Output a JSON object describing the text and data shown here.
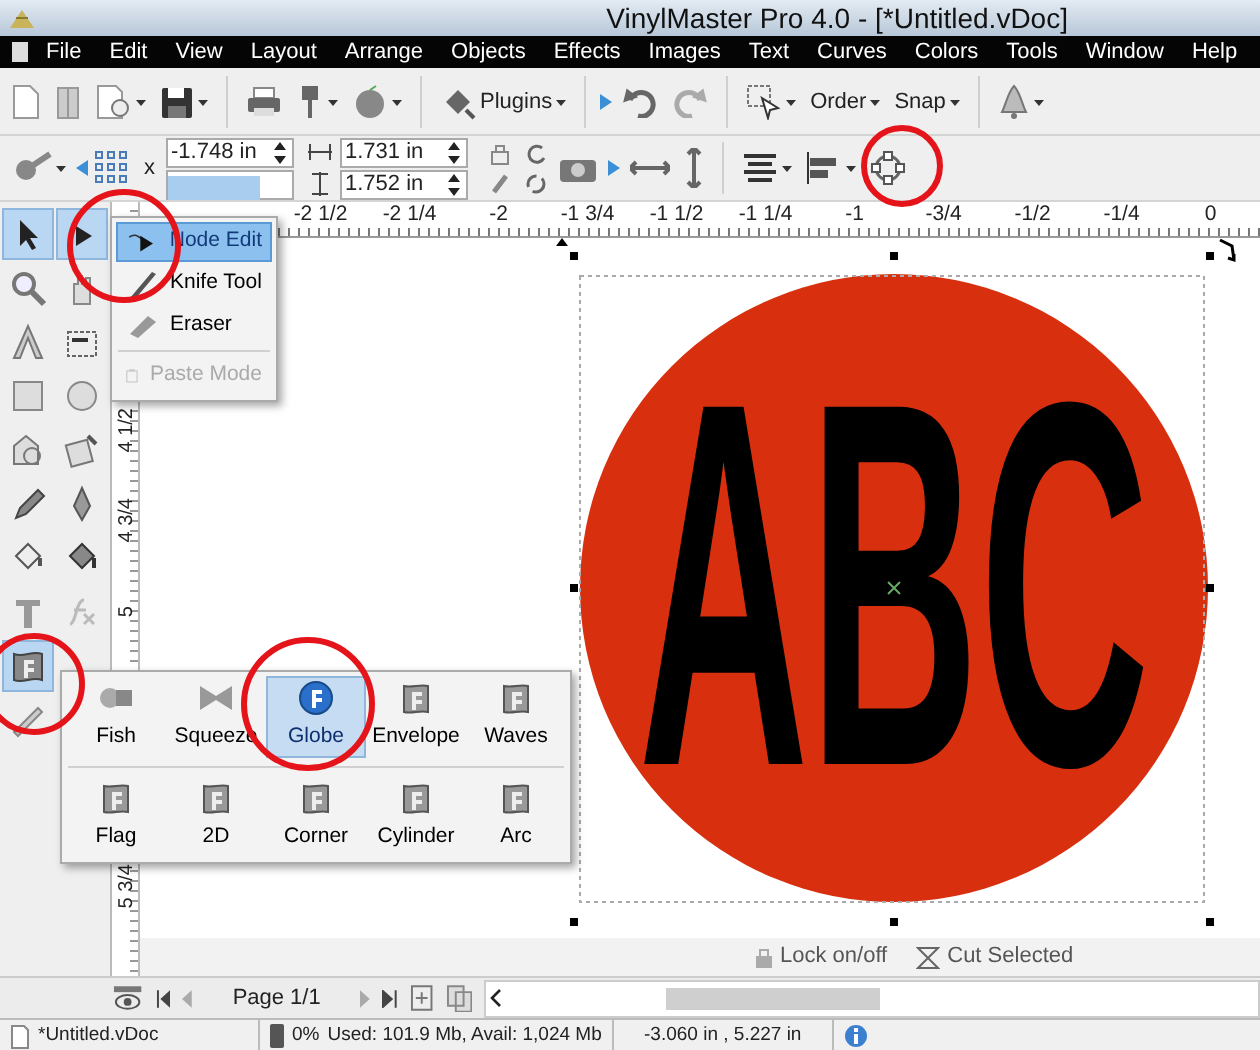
{
  "window": {
    "title": "VinylMaster Pro 4.0 - [*Untitled.vDoc]"
  },
  "menu": [
    "File",
    "Edit",
    "View",
    "Layout",
    "Arrange",
    "Objects",
    "Effects",
    "Images",
    "Text",
    "Curves",
    "Colors",
    "Tools",
    "Window",
    "Help"
  ],
  "toolbar": {
    "buttons": [
      "Plugins",
      "Order",
      "Snap"
    ]
  },
  "property_bar": {
    "x_label": "x",
    "x_value": "-1.748 in",
    "width_value": "1.731 in",
    "height_value": "1.752 in"
  },
  "tool_palette": [
    {
      "selected": true
    },
    {
      "selected": true
    },
    {
      "selected": false
    },
    {
      "selected": false
    },
    {
      "selected": false
    },
    {
      "selected": false
    },
    {
      "selected": false
    },
    {
      "selected": false
    },
    {
      "selected": false
    },
    {
      "selected": false
    },
    {
      "selected": false
    },
    {
      "selected": false
    },
    {
      "selected": false
    },
    {
      "selected": false
    },
    {
      "selected": false
    },
    {
      "selected": false
    },
    {
      "selected": true
    },
    {
      "selected": false
    }
  ],
  "node_menu": [
    {
      "label": "Node Edit",
      "selected": true,
      "disabled": false
    },
    {
      "label": "Knife Tool",
      "selected": false,
      "disabled": false
    },
    {
      "label": "Eraser",
      "selected": false,
      "disabled": false
    },
    {
      "label": "Paste Mode",
      "selected": false,
      "disabled": true
    }
  ],
  "ruler": {
    "horizontal": [
      "-2 1/2",
      "-2 1/4",
      "-2",
      "-1 3/4",
      "-1 1/2",
      "-1 1/4",
      "-1",
      "-3/4",
      "-1/2",
      "-1/4",
      "0"
    ],
    "vertical": [
      {
        "label": "4 1/2",
        "after_gap": false
      },
      {
        "label": "4 3/4",
        "after_gap": false
      },
      {
        "label": "5",
        "after_gap": false
      },
      {
        "label": "5 3/4",
        "after_gap": true
      }
    ]
  },
  "canvas": {
    "artwork_text": "ABC",
    "actions": [
      "Lock on/off",
      "Cut Selected"
    ]
  },
  "envelope_menu": [
    {
      "label": "Fish",
      "selected": false
    },
    {
      "label": "Squeeze",
      "selected": false
    },
    {
      "label": "Globe",
      "selected": true
    },
    {
      "label": "Envelope",
      "selected": false
    },
    {
      "label": "Waves",
      "selected": false
    },
    {
      "label": "Flag",
      "selected": false
    },
    {
      "label": "2D",
      "selected": false
    },
    {
      "label": "Corner",
      "selected": false
    },
    {
      "label": "Cylinder",
      "selected": false
    },
    {
      "label": "Arc",
      "selected": false
    }
  ],
  "page_nav": {
    "label": "Page 1/1"
  },
  "status_bar": {
    "file": "*Untitled.vDoc",
    "memory_percent": "0%",
    "memory": "Used: 101.9 Mb, Avail: 1,024 Mb",
    "coordinates": "-3.060 in , 5.227 in"
  }
}
